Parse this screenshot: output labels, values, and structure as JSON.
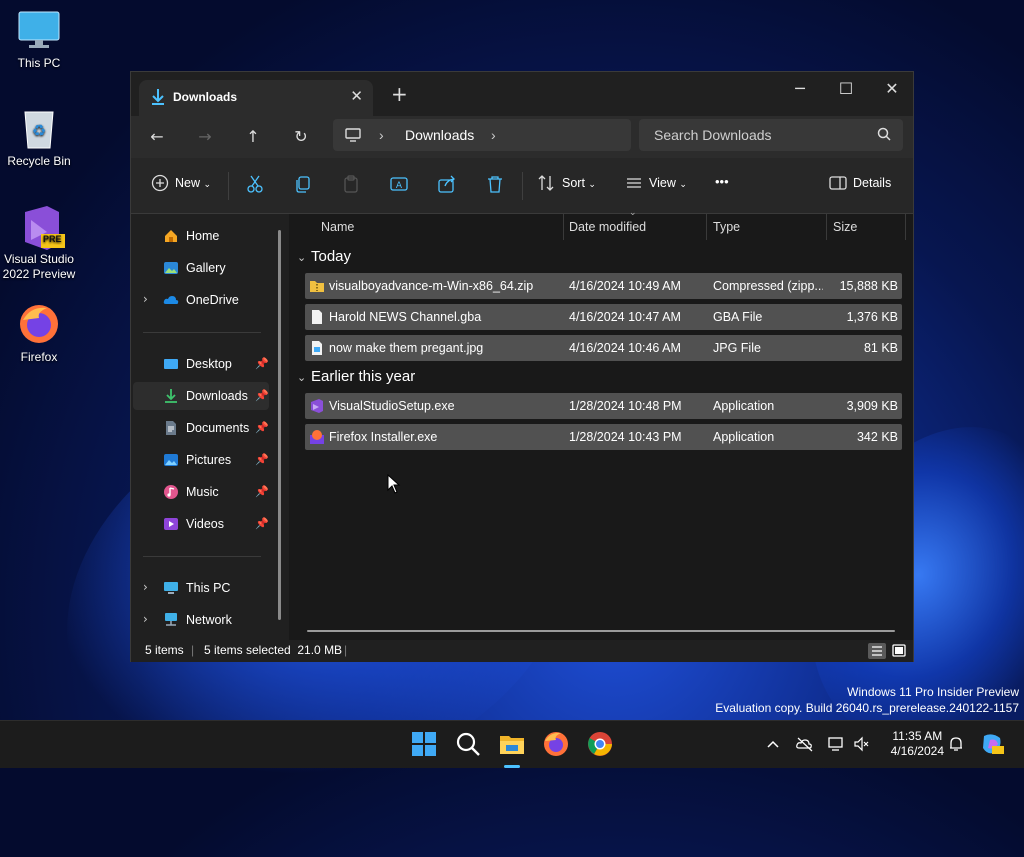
{
  "desktop": {
    "icons": [
      {
        "label": "This PC"
      },
      {
        "label": "Recycle Bin"
      },
      {
        "label": "Visual Studio 2022 Preview"
      },
      {
        "label": "Firefox"
      }
    ],
    "vs_badge": "PRE"
  },
  "window": {
    "tab_title": "Downloads",
    "address": {
      "segment": "Downloads"
    },
    "search_placeholder": "Search Downloads",
    "toolbar": {
      "new_label": "New",
      "sort_label": "Sort",
      "view_label": "View",
      "more_label": "•••",
      "details_label": "Details"
    },
    "sidebar": {
      "items": [
        {
          "label": "Home"
        },
        {
          "label": "Gallery"
        },
        {
          "label": "OneDrive"
        },
        {
          "label": "Desktop"
        },
        {
          "label": "Downloads"
        },
        {
          "label": "Documents"
        },
        {
          "label": "Pictures"
        },
        {
          "label": "Music"
        },
        {
          "label": "Videos"
        },
        {
          "label": "This PC"
        },
        {
          "label": "Network"
        }
      ]
    },
    "columns": {
      "name": "Name",
      "date": "Date modified",
      "type": "Type",
      "size": "Size"
    },
    "groups": [
      {
        "label": "Today",
        "files": [
          {
            "name": "visualboyadvance-m-Win-x86_64.zip",
            "date": "4/16/2024 10:49 AM",
            "type": "Compressed (zipp...",
            "size": "15,888 KB"
          },
          {
            "name": "Harold NEWS Channel.gba",
            "date": "4/16/2024 10:47 AM",
            "type": "GBA File",
            "size": "1,376 KB"
          },
          {
            "name": "now make them pregant.jpg",
            "date": "4/16/2024 10:46 AM",
            "type": "JPG File",
            "size": "81 KB"
          }
        ]
      },
      {
        "label": "Earlier this year",
        "files": [
          {
            "name": "VisualStudioSetup.exe",
            "date": "1/28/2024 10:48 PM",
            "type": "Application",
            "size": "3,909 KB"
          },
          {
            "name": "Firefox Installer.exe",
            "date": "1/28/2024 10:43 PM",
            "type": "Application",
            "size": "342 KB"
          }
        ]
      }
    ],
    "status": {
      "items": "5 items",
      "selected": "5 items selected  21.0 MB"
    }
  },
  "watermark": {
    "line1": "Windows 11 Pro Insider Preview",
    "line2": "Evaluation copy. Build 26040.rs_prerelease.240122-1157"
  },
  "clock": {
    "time": "11:35 AM",
    "date": "4/16/2024"
  },
  "colors": {
    "accent": "#4cc2ff",
    "folder": "#f0c040",
    "window_bg": "#191919",
    "row_selected": "#7a7a7a"
  }
}
